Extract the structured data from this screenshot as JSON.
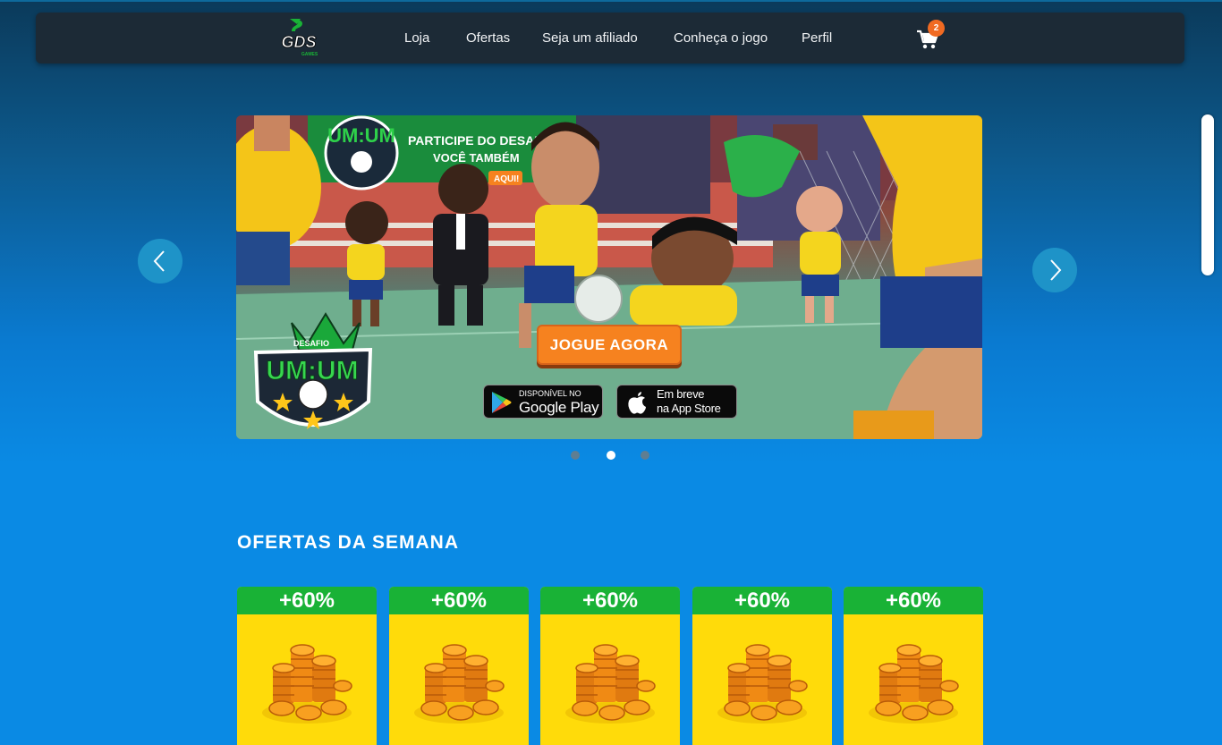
{
  "brand": {
    "logo_text": "GDS",
    "logo_sub": "GAMES"
  },
  "nav": {
    "links": [
      "Loja",
      "Ofertas",
      "Seja um afiliado",
      "Conheça o jogo",
      "Perfil"
    ],
    "cart_count": "2"
  },
  "carousel": {
    "banner_text_top": "PARTICIPE DO DESAFIO",
    "banner_text_mid": "VOCÊ TAMBÉM",
    "banner_text_aqui": "AQUI!",
    "game_logo_small": "DESAFIO",
    "game_logo_main": "UM:UM",
    "play_button": "JOGUE AGORA",
    "google_play": {
      "small": "DISPONÍVEL NO",
      "big": "Google Play"
    },
    "app_store": {
      "small": "Em breve",
      "big": "na App Store"
    },
    "active_index": 1,
    "slide_count": 3
  },
  "offers": {
    "title": "OFERTAS DA SEMANA",
    "items": [
      {
        "badge": "+60%"
      },
      {
        "badge": "+60%"
      },
      {
        "badge": "+60%"
      },
      {
        "badge": "+60%"
      },
      {
        "badge": "+60%"
      }
    ]
  },
  "colors": {
    "accent_orange": "#f6821f",
    "offer_green": "#19b236",
    "offer_yellow": "#ffdb0a",
    "navbar": "#1c2a36"
  }
}
